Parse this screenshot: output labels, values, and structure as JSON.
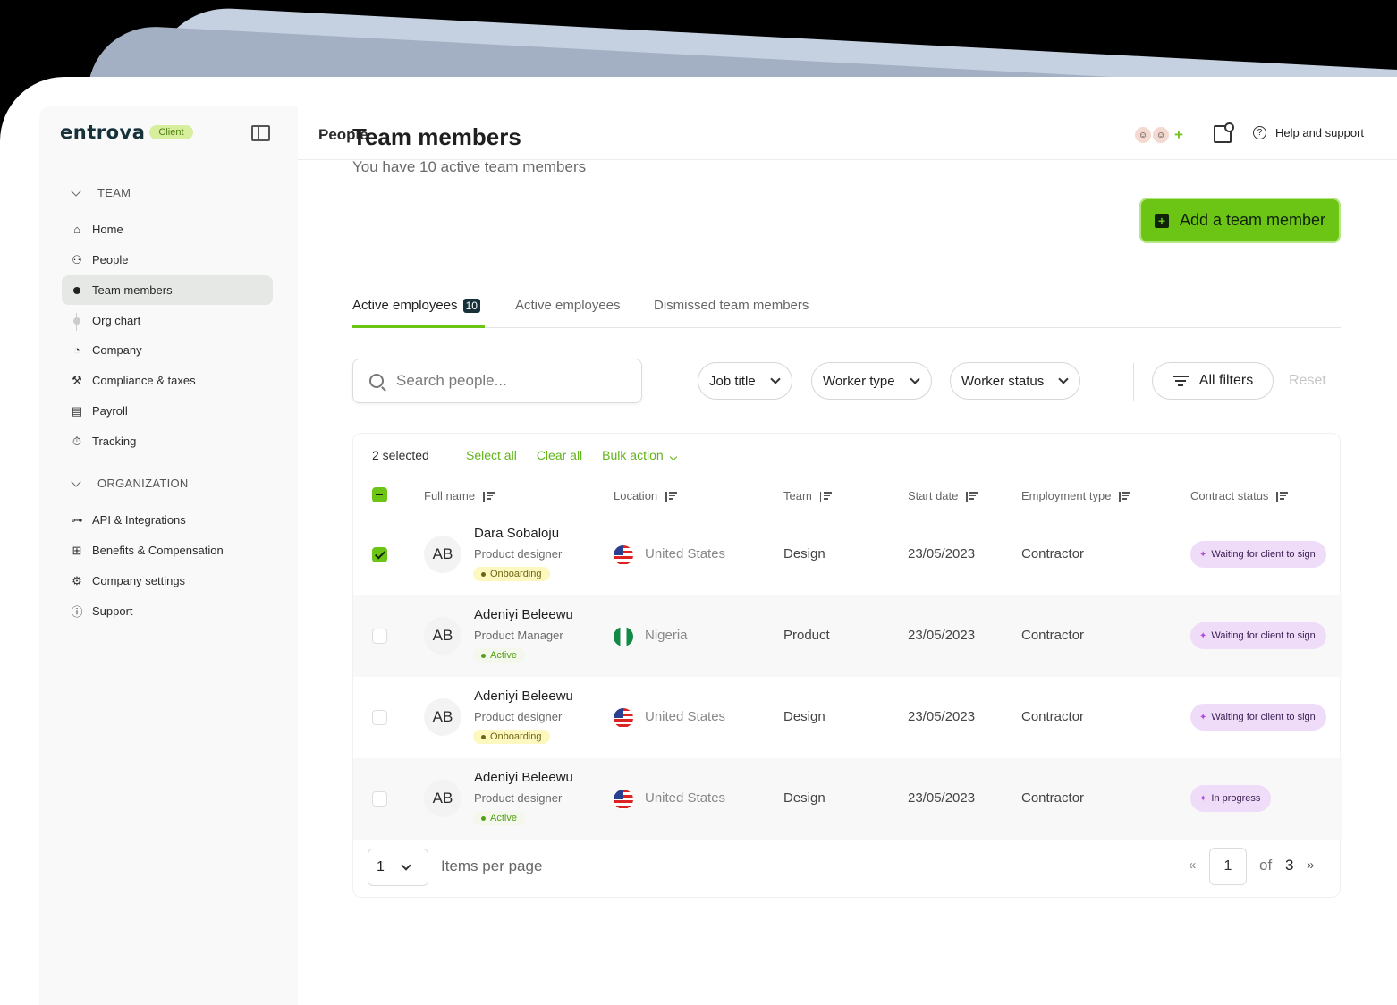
{
  "brand": {
    "logo": "entrova",
    "badge": "Client"
  },
  "sidebar": {
    "team_section": "TEAM",
    "team_items": [
      {
        "label": "Home",
        "icon": "home-icon"
      },
      {
        "label": "People",
        "icon": "people-icon"
      },
      {
        "label": "Team members",
        "icon": "bullet-icon",
        "active": true
      },
      {
        "label": "Org chart",
        "icon": "bullet-icon"
      },
      {
        "label": "Company",
        "icon": "pie-icon"
      },
      {
        "label": "Compliance & taxes",
        "icon": "gavel-icon"
      },
      {
        "label": "Payroll",
        "icon": "wallet-icon"
      },
      {
        "label": "Tracking",
        "icon": "timer-icon"
      }
    ],
    "org_section": "ORGANIZATION",
    "org_items": [
      {
        "label": "API & Integrations",
        "icon": "hierarchy-icon"
      },
      {
        "label": "Benefits & Compensation",
        "icon": "gift-icon"
      },
      {
        "label": "Company settings",
        "icon": "gear-icon"
      },
      {
        "label": "Support",
        "icon": "question-icon"
      }
    ]
  },
  "topbar": {
    "title": "People",
    "help": "Help and support"
  },
  "main": {
    "title": "Team members",
    "subtitle": "You have 10 active team members",
    "add_button": "Add a team member",
    "tabs": [
      {
        "label": "Active employees",
        "count": "10"
      },
      {
        "label": "Active employees"
      },
      {
        "label": "Dismissed team members"
      }
    ],
    "search_placeholder": "Search people...",
    "filters": [
      "Job title",
      "Worker type",
      "Worker status"
    ],
    "all_filters": "All filters",
    "reset": "Reset"
  },
  "table": {
    "selected": "2 selected",
    "select_all": "Select all",
    "clear_all": "Clear all",
    "bulk_action": "Bulk action",
    "columns": [
      "Full name",
      "Location",
      "Team",
      "Start date",
      "Employment type",
      "Contract status"
    ],
    "rows": [
      {
        "initials": "AB",
        "name": "Dara Sobaloju",
        "role": "Product designer",
        "badge": "Onboarding",
        "location": "United States",
        "flag": "us",
        "team": "Design",
        "start": "23/05/2023",
        "employment": "Contractor",
        "status": "Waiting for client to sign",
        "checked": true
      },
      {
        "initials": "AB",
        "name": "Adeniyi Beleewu",
        "role": "Product Manager",
        "badge": "Active",
        "location": "Nigeria",
        "flag": "ng",
        "team": "Product",
        "start": "23/05/2023",
        "employment": "Contractor",
        "status": "Waiting for client to sign",
        "checked": false
      },
      {
        "initials": "AB",
        "name": "Adeniyi Beleewu",
        "role": "Product designer",
        "badge": "Onboarding",
        "location": "United States",
        "flag": "us",
        "team": "Design",
        "start": "23/05/2023",
        "employment": "Contractor",
        "status": "Waiting for client to sign",
        "checked": false
      },
      {
        "initials": "AB",
        "name": "Adeniyi Beleewu",
        "role": "Product designer",
        "badge": "Active",
        "location": "United States",
        "flag": "us",
        "team": "Design",
        "start": "23/05/2023",
        "employment": "Contractor",
        "status": "In progress",
        "checked": false
      }
    ]
  },
  "pagination": {
    "per_page_value": "1",
    "per_page_label": "Items per page",
    "prev": "«",
    "current": "1",
    "of": "of",
    "total": "3",
    "next": "»"
  },
  "colors": {
    "accent": "#6cc515",
    "brand_dark": "#17313a",
    "status_bg": "#efdcf8"
  }
}
